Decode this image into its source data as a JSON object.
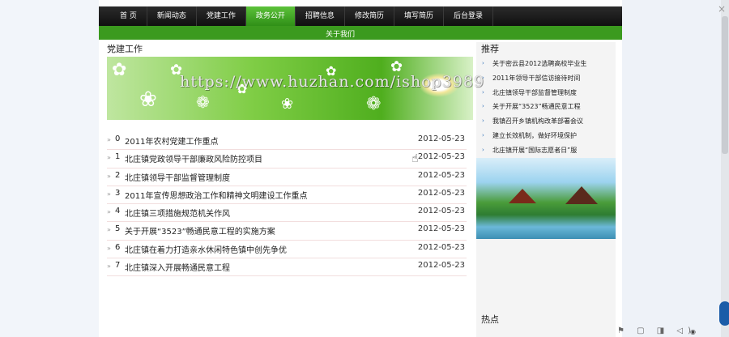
{
  "nav": {
    "items": [
      "首 页",
      "新闻动态",
      "党建工作",
      "政务公开",
      "招聘信息",
      "修改简历",
      "填写简历",
      "后台登录"
    ],
    "active_index": 3
  },
  "subbar": {
    "link": "关于我们"
  },
  "section": {
    "title": "党建工作"
  },
  "watermark": "https://www.huzhan.com/ishop3989",
  "news": [
    {
      "index": "0",
      "title": "2011年农村党建工作重点",
      "date": "2012-05-23"
    },
    {
      "index": "1",
      "title": "北庄镇党政领导干部廉政风险防控项目",
      "date": "2012-05-23"
    },
    {
      "index": "2",
      "title": "北庄镇领导干部监督管理制度",
      "date": "2012-05-23"
    },
    {
      "index": "3",
      "title": "2011年宣传思想政治工作和精神文明建设工作重点",
      "date": "2012-05-23"
    },
    {
      "index": "4",
      "title": "北庄镇三项措施规范机关作风",
      "date": "2012-05-23"
    },
    {
      "index": "5",
      "title": "关于开展“3523”畅通民意工程的实施方案",
      "date": "2012-05-23"
    },
    {
      "index": "6",
      "title": "北庄镇在着力打造亲水休闲特色镇中创先争优",
      "date": "2012-05-23"
    },
    {
      "index": "7",
      "title": "北庄镇深入开展畅通民意工程",
      "date": "2012-05-23"
    }
  ],
  "recommend": {
    "title": "推荐",
    "items": [
      "关于密云县2012选聘高校毕业生",
      "2011年领导干部信访接待时间",
      "北庄镇领导干部监督管理制度",
      "关于开展“3523”畅通民意工程",
      "我镇召开乡镇机构改革部署会议",
      "建立长效机制，做好环境保护",
      "北庄镇开展“国际志愿者日”服"
    ]
  },
  "hot": {
    "title": "热点"
  }
}
